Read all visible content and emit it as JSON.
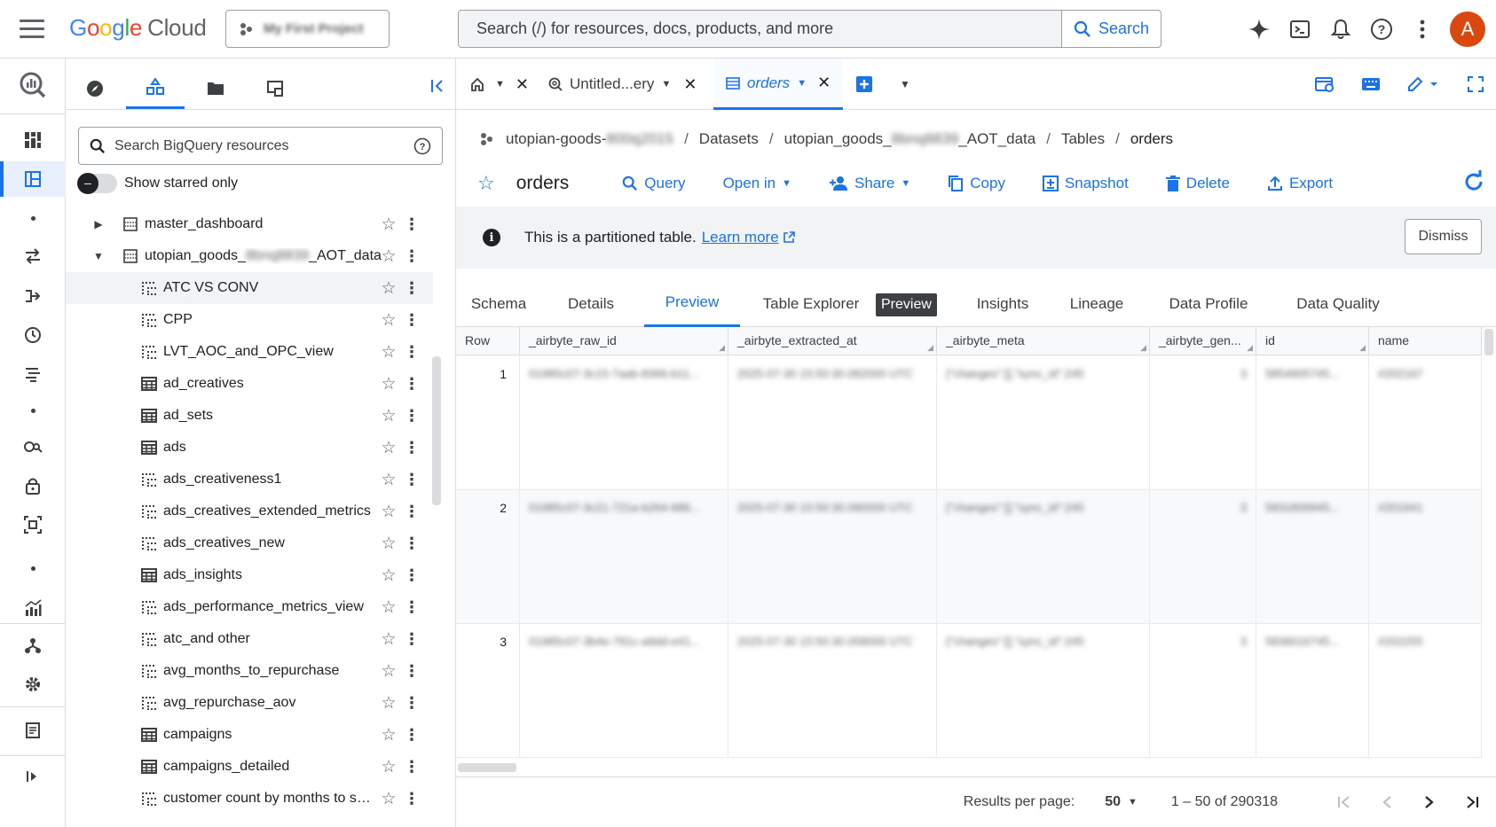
{
  "header": {
    "logo_google": "Google",
    "logo_cloud": "Cloud",
    "project": "My First Project",
    "search_placeholder": "Search (/) for resources, docs, products, and more",
    "search_button": "Search",
    "avatar_letter": "A"
  },
  "explorer": {
    "search_placeholder": "Search BigQuery resources",
    "show_starred_label": "Show starred only",
    "datasets": [
      {
        "name": "master_dashboard",
        "expanded": false
      },
      {
        "name_prefix": "utopian_goods_",
        "name_blur": "8bnq8839",
        "name_suffix": "_AOT_data",
        "expanded": true
      }
    ],
    "tables": [
      {
        "name": "ATC VS CONV",
        "kind": "view"
      },
      {
        "name": "CPP",
        "kind": "view"
      },
      {
        "name": "LVT_AOC_and_OPC_view",
        "kind": "view"
      },
      {
        "name": "ad_creatives",
        "kind": "table"
      },
      {
        "name": "ad_sets",
        "kind": "table"
      },
      {
        "name": "ads",
        "kind": "table"
      },
      {
        "name": "ads_creativeness1",
        "kind": "view"
      },
      {
        "name": "ads_creatives_extended_metrics",
        "kind": "view"
      },
      {
        "name": "ads_creatives_new",
        "kind": "view"
      },
      {
        "name": "ads_insights",
        "kind": "table"
      },
      {
        "name": "ads_performance_metrics_view",
        "kind": "view"
      },
      {
        "name": "atc_and other",
        "kind": "view"
      },
      {
        "name": "avg_months_to_repurchase",
        "kind": "view"
      },
      {
        "name": "avg_repurchase_aov",
        "kind": "view"
      },
      {
        "name": "campaigns",
        "kind": "table"
      },
      {
        "name": "campaigns_detailed",
        "kind": "table"
      },
      {
        "name": "customer count by months to secor",
        "kind": "view"
      }
    ]
  },
  "tabs": {
    "untitled": "Untitled...ery",
    "orders": "orders"
  },
  "breadcrumb": {
    "project_prefix": "utopian-goods-",
    "project_blur": "800q2015",
    "datasets": "Datasets",
    "dataset_prefix": "utopian_goods_",
    "dataset_blur": "8bnq8839",
    "dataset_suffix": "_AOT_data",
    "tables": "Tables",
    "current": "orders"
  },
  "actions": {
    "title": "orders",
    "query": "Query",
    "open_in": "Open in",
    "share": "Share",
    "copy": "Copy",
    "snapshot": "Snapshot",
    "delete": "Delete",
    "export": "Export"
  },
  "banner": {
    "text": "This is a partitioned table.",
    "link": "Learn more",
    "dismiss": "Dismiss"
  },
  "subtabs": {
    "schema": "Schema",
    "details": "Details",
    "preview": "Preview",
    "table_explorer": "Table Explorer",
    "preview_badge": "Preview",
    "insights": "Insights",
    "lineage": "Lineage",
    "data_profile": "Data Profile",
    "data_quality": "Data Quality"
  },
  "grid": {
    "columns": [
      "Row",
      "_airbyte_raw_id",
      "_airbyte_extracted_at",
      "_airbyte_meta",
      "_airbyte_gen...",
      "id",
      "name"
    ],
    "rows": [
      {
        "row": "1",
        "raw_id": "01985c07-3c15-7aab-8366-b11...",
        "extracted_at": "2025-07-30 15:50:30.082000 UTC",
        "meta": "{\"changes\":[],\"sync_id\":245",
        "gen": "3",
        "id": "5854905745...",
        "name": "#202167"
      },
      {
        "row": "2",
        "raw_id": "01985c07-3c21-721a-b264-686...",
        "extracted_at": "2025-07-30 15:50:30.090000 UTC",
        "meta": "{\"changes\":[],\"sync_id\":245",
        "gen": "3",
        "id": "5831809945...",
        "name": "#201941"
      },
      {
        "row": "3",
        "raw_id": "01985c07-3b4e-791c-a9dd-e41...",
        "extracted_at": "2025-07-30 15:50:30.058000 UTC",
        "meta": "{\"changes\":[],\"sync_id\":245",
        "gen": "3",
        "id": "5836016745...",
        "name": "#202255"
      }
    ]
  },
  "pager": {
    "rpp_label": "Results per page:",
    "rpp_value": "50",
    "range": "1 – 50 of 290318"
  }
}
